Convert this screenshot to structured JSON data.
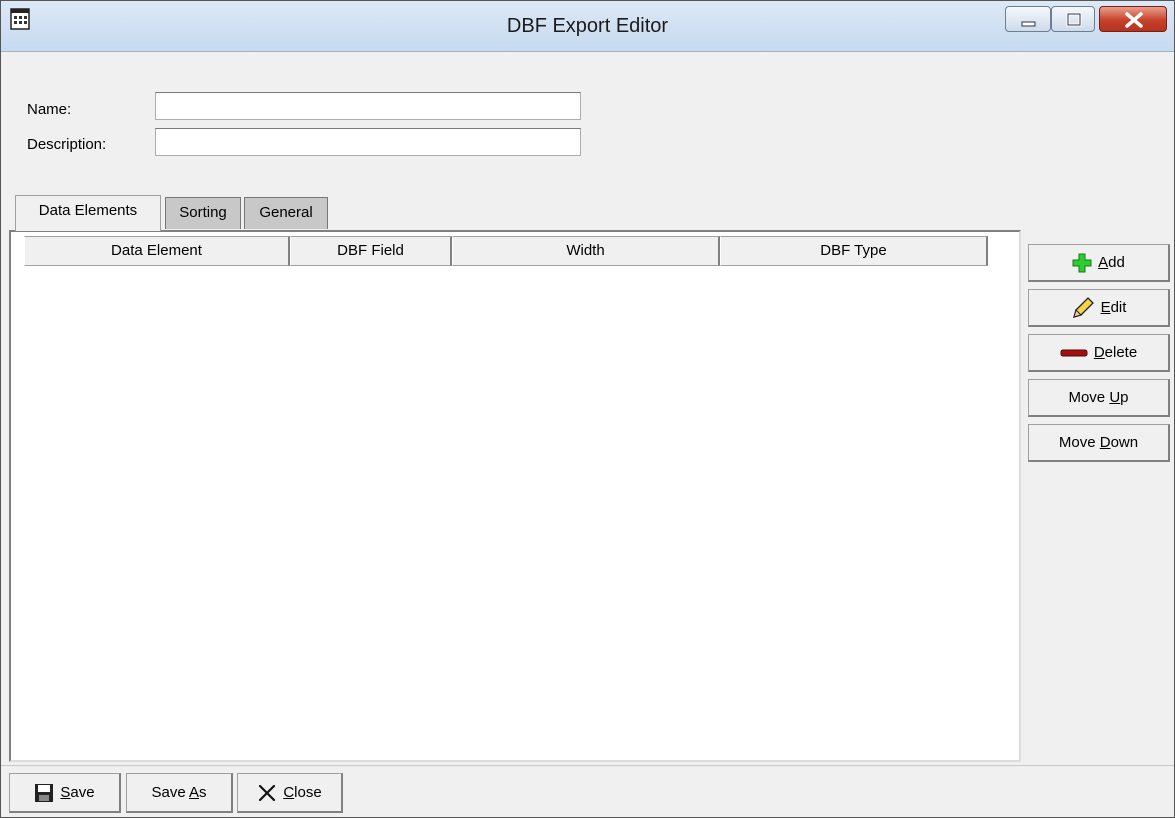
{
  "window": {
    "title": "DBF Export Editor"
  },
  "form": {
    "name_label": "Name:",
    "name_value": "",
    "description_label": "Description:",
    "description_value": ""
  },
  "tabs": [
    {
      "label": "Data Elements",
      "active": true
    },
    {
      "label": "Sorting",
      "active": false
    },
    {
      "label": "General",
      "active": false
    }
  ],
  "grid": {
    "columns": [
      "Data Element",
      "DBF Field",
      "Width",
      "DBF Type"
    ],
    "rows": []
  },
  "side_buttons": {
    "add": {
      "prefix": "",
      "mnemonic": "A",
      "suffix": "dd",
      "icon": "plus-icon"
    },
    "edit": {
      "prefix": "",
      "mnemonic": "E",
      "suffix": "dit",
      "icon": "pencil-icon"
    },
    "delete": {
      "prefix": "",
      "mnemonic": "D",
      "suffix": "elete",
      "icon": "minus-icon"
    },
    "move_up": {
      "prefix": "Move ",
      "mnemonic": "U",
      "suffix": "p"
    },
    "move_down": {
      "prefix": "Move ",
      "mnemonic": "D",
      "suffix": "own"
    }
  },
  "bottom_buttons": {
    "save": {
      "prefix": "",
      "mnemonic": "S",
      "suffix": "ave",
      "icon": "floppy-disk-icon"
    },
    "save_as": {
      "prefix": "Save ",
      "mnemonic": "A",
      "suffix": "s"
    },
    "close": {
      "prefix": "",
      "mnemonic": "C",
      "suffix": "lose",
      "icon": "x-icon"
    }
  }
}
